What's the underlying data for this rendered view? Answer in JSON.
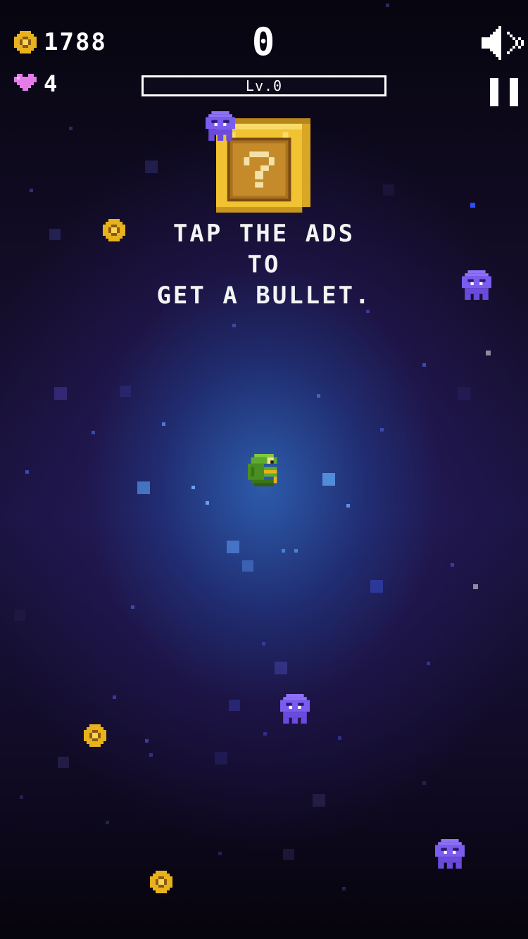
{
  "hud": {
    "coins": "1788",
    "lives": "4",
    "score": "0",
    "level_label": "Lv.0",
    "level_progress": 0
  },
  "hint": {
    "line1": "TAP THE ADS",
    "line2": "TO",
    "line3": "GET A BULLET."
  },
  "icons": {
    "coin": "coin-icon",
    "heart": "heart-icon",
    "sound": "sound-off-icon",
    "pause": "pause-icon",
    "mystery_box": "question-block-icon",
    "player": "green-pixel-creature",
    "enemy": "purple-ghost-enemy"
  },
  "colors": {
    "coin": "#e8b21c",
    "heart": "#e57be8",
    "enemy": "#7b5cf0",
    "player": "#5cab2f",
    "block": "#f1c232"
  }
}
